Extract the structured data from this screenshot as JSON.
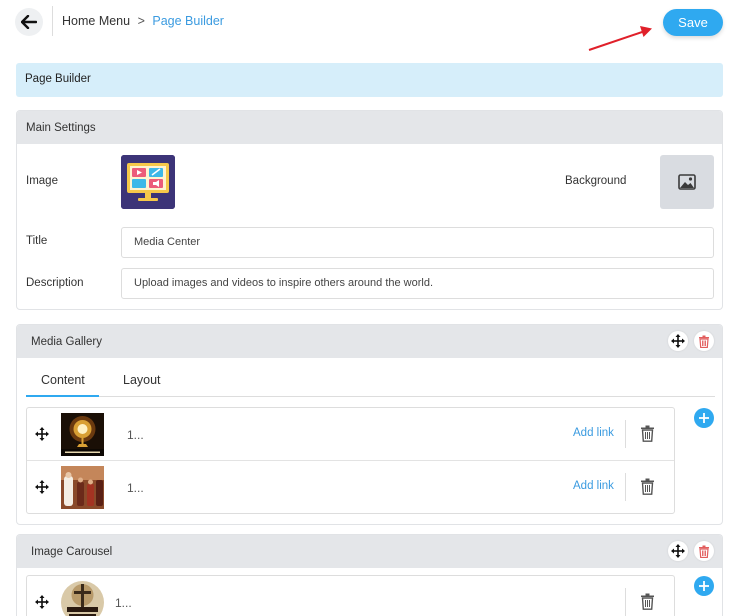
{
  "header": {
    "breadcrumb_home": "Home Menu",
    "breadcrumb_sep": ">",
    "breadcrumb_current": "Page Builder",
    "save_label": "Save",
    "back_icon": "arrow-left-icon",
    "annotation_arrow_color": "#e0202a"
  },
  "banner": {
    "title": "Page Builder"
  },
  "main_settings": {
    "title": "Main Settings",
    "image_label": "Image",
    "background_label": "Background",
    "title_label": "Title",
    "title_value": "Media Center",
    "description_label": "Description",
    "description_value": "Upload images and videos to inspire others around the world."
  },
  "media_gallery": {
    "title": "Media Gallery",
    "tabs": [
      {
        "label": "Content",
        "active": true
      },
      {
        "label": "Layout",
        "active": false
      }
    ],
    "items": [
      {
        "text": "1...",
        "link_label": "Add link"
      },
      {
        "text": "1...",
        "link_label": "Add link"
      }
    ]
  },
  "image_carousel": {
    "title": "Image Carousel",
    "items": [
      {
        "text": "1..."
      }
    ]
  },
  "colors": {
    "accent": "#2fa9f0",
    "link": "#3b9be0",
    "banner_bg": "#d6eefa",
    "panel_head_bg": "#e4e6e9",
    "danger": "#e25d5d"
  }
}
